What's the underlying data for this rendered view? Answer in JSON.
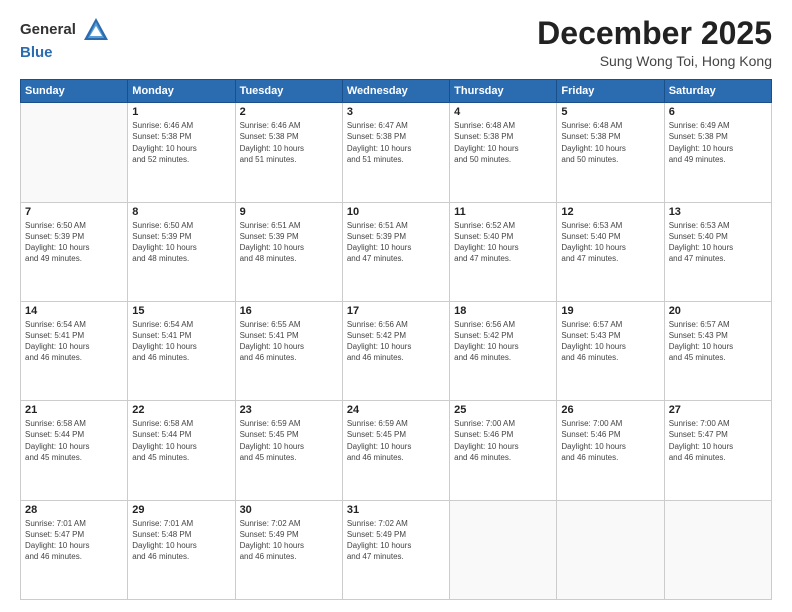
{
  "header": {
    "logo_general": "General",
    "logo_blue": "Blue",
    "month": "December 2025",
    "location": "Sung Wong Toi, Hong Kong"
  },
  "weekdays": [
    "Sunday",
    "Monday",
    "Tuesday",
    "Wednesday",
    "Thursday",
    "Friday",
    "Saturday"
  ],
  "weeks": [
    [
      {
        "day": "",
        "detail": ""
      },
      {
        "day": "1",
        "detail": "Sunrise: 6:46 AM\nSunset: 5:38 PM\nDaylight: 10 hours\nand 52 minutes."
      },
      {
        "day": "2",
        "detail": "Sunrise: 6:46 AM\nSunset: 5:38 PM\nDaylight: 10 hours\nand 51 minutes."
      },
      {
        "day": "3",
        "detail": "Sunrise: 6:47 AM\nSunset: 5:38 PM\nDaylight: 10 hours\nand 51 minutes."
      },
      {
        "day": "4",
        "detail": "Sunrise: 6:48 AM\nSunset: 5:38 PM\nDaylight: 10 hours\nand 50 minutes."
      },
      {
        "day": "5",
        "detail": "Sunrise: 6:48 AM\nSunset: 5:38 PM\nDaylight: 10 hours\nand 50 minutes."
      },
      {
        "day": "6",
        "detail": "Sunrise: 6:49 AM\nSunset: 5:38 PM\nDaylight: 10 hours\nand 49 minutes."
      }
    ],
    [
      {
        "day": "7",
        "detail": "Sunrise: 6:50 AM\nSunset: 5:39 PM\nDaylight: 10 hours\nand 49 minutes."
      },
      {
        "day": "8",
        "detail": "Sunrise: 6:50 AM\nSunset: 5:39 PM\nDaylight: 10 hours\nand 48 minutes."
      },
      {
        "day": "9",
        "detail": "Sunrise: 6:51 AM\nSunset: 5:39 PM\nDaylight: 10 hours\nand 48 minutes."
      },
      {
        "day": "10",
        "detail": "Sunrise: 6:51 AM\nSunset: 5:39 PM\nDaylight: 10 hours\nand 47 minutes."
      },
      {
        "day": "11",
        "detail": "Sunrise: 6:52 AM\nSunset: 5:40 PM\nDaylight: 10 hours\nand 47 minutes."
      },
      {
        "day": "12",
        "detail": "Sunrise: 6:53 AM\nSunset: 5:40 PM\nDaylight: 10 hours\nand 47 minutes."
      },
      {
        "day": "13",
        "detail": "Sunrise: 6:53 AM\nSunset: 5:40 PM\nDaylight: 10 hours\nand 47 minutes."
      }
    ],
    [
      {
        "day": "14",
        "detail": "Sunrise: 6:54 AM\nSunset: 5:41 PM\nDaylight: 10 hours\nand 46 minutes."
      },
      {
        "day": "15",
        "detail": "Sunrise: 6:54 AM\nSunset: 5:41 PM\nDaylight: 10 hours\nand 46 minutes."
      },
      {
        "day": "16",
        "detail": "Sunrise: 6:55 AM\nSunset: 5:41 PM\nDaylight: 10 hours\nand 46 minutes."
      },
      {
        "day": "17",
        "detail": "Sunrise: 6:56 AM\nSunset: 5:42 PM\nDaylight: 10 hours\nand 46 minutes."
      },
      {
        "day": "18",
        "detail": "Sunrise: 6:56 AM\nSunset: 5:42 PM\nDaylight: 10 hours\nand 46 minutes."
      },
      {
        "day": "19",
        "detail": "Sunrise: 6:57 AM\nSunset: 5:43 PM\nDaylight: 10 hours\nand 46 minutes."
      },
      {
        "day": "20",
        "detail": "Sunrise: 6:57 AM\nSunset: 5:43 PM\nDaylight: 10 hours\nand 45 minutes."
      }
    ],
    [
      {
        "day": "21",
        "detail": "Sunrise: 6:58 AM\nSunset: 5:44 PM\nDaylight: 10 hours\nand 45 minutes."
      },
      {
        "day": "22",
        "detail": "Sunrise: 6:58 AM\nSunset: 5:44 PM\nDaylight: 10 hours\nand 45 minutes."
      },
      {
        "day": "23",
        "detail": "Sunrise: 6:59 AM\nSunset: 5:45 PM\nDaylight: 10 hours\nand 45 minutes."
      },
      {
        "day": "24",
        "detail": "Sunrise: 6:59 AM\nSunset: 5:45 PM\nDaylight: 10 hours\nand 46 minutes."
      },
      {
        "day": "25",
        "detail": "Sunrise: 7:00 AM\nSunset: 5:46 PM\nDaylight: 10 hours\nand 46 minutes."
      },
      {
        "day": "26",
        "detail": "Sunrise: 7:00 AM\nSunset: 5:46 PM\nDaylight: 10 hours\nand 46 minutes."
      },
      {
        "day": "27",
        "detail": "Sunrise: 7:00 AM\nSunset: 5:47 PM\nDaylight: 10 hours\nand 46 minutes."
      }
    ],
    [
      {
        "day": "28",
        "detail": "Sunrise: 7:01 AM\nSunset: 5:47 PM\nDaylight: 10 hours\nand 46 minutes."
      },
      {
        "day": "29",
        "detail": "Sunrise: 7:01 AM\nSunset: 5:48 PM\nDaylight: 10 hours\nand 46 minutes."
      },
      {
        "day": "30",
        "detail": "Sunrise: 7:02 AM\nSunset: 5:49 PM\nDaylight: 10 hours\nand 46 minutes."
      },
      {
        "day": "31",
        "detail": "Sunrise: 7:02 AM\nSunset: 5:49 PM\nDaylight: 10 hours\nand 47 minutes."
      },
      {
        "day": "",
        "detail": ""
      },
      {
        "day": "",
        "detail": ""
      },
      {
        "day": "",
        "detail": ""
      }
    ]
  ]
}
